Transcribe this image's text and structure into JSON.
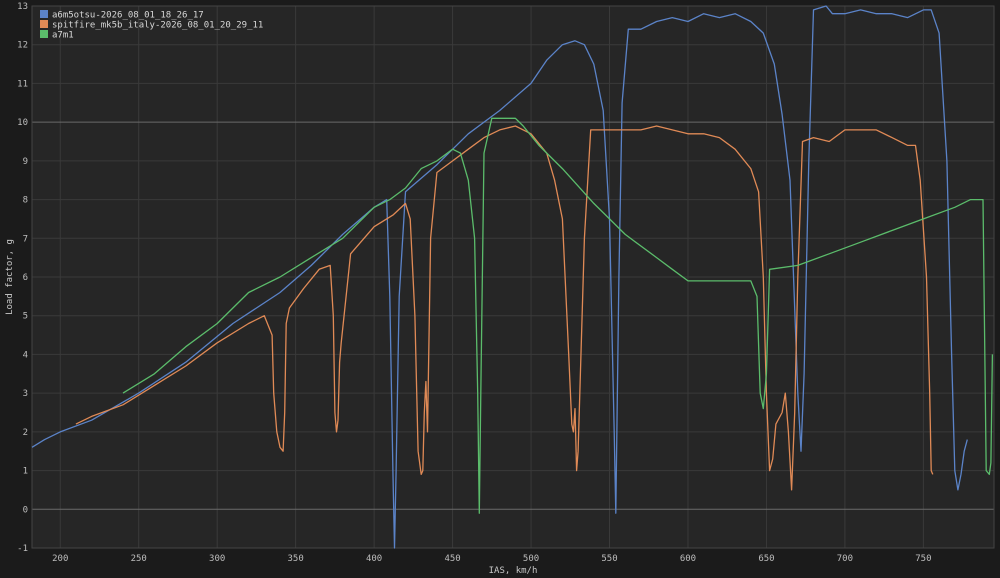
{
  "chart_data": {
    "type": "line",
    "xlabel": "IAS, km/h",
    "ylabel": "Load factor, g",
    "xlim": [
      182,
      795
    ],
    "ylim": [
      -1,
      13
    ],
    "xticks": [
      200,
      250,
      300,
      350,
      400,
      450,
      500,
      550,
      600,
      650,
      700,
      750
    ],
    "yticks": [
      -1,
      0,
      1,
      2,
      3,
      4,
      5,
      6,
      7,
      8,
      9,
      10,
      11,
      12,
      13
    ],
    "grid": true,
    "highlight_lines": [
      0,
      10
    ],
    "legend_position": "top-left",
    "series": [
      {
        "name": "a6m5otsu-2026_08_01_18_26_17",
        "color": "#5b83c8",
        "points": [
          [
            182,
            1.6
          ],
          [
            190,
            1.8
          ],
          [
            200,
            2.0
          ],
          [
            220,
            2.3
          ],
          [
            250,
            3.0
          ],
          [
            280,
            3.8
          ],
          [
            310,
            4.8
          ],
          [
            340,
            5.6
          ],
          [
            360,
            6.3
          ],
          [
            380,
            7.1
          ],
          [
            400,
            7.8
          ],
          [
            408,
            8.0
          ],
          [
            410,
            5.5
          ],
          [
            412,
            1.0
          ],
          [
            413,
            -1.0
          ],
          [
            414,
            1.0
          ],
          [
            416,
            5.5
          ],
          [
            420,
            8.2
          ],
          [
            440,
            8.9
          ],
          [
            460,
            9.7
          ],
          [
            480,
            10.3
          ],
          [
            500,
            11.0
          ],
          [
            510,
            11.6
          ],
          [
            520,
            12.0
          ],
          [
            528,
            12.1
          ],
          [
            534,
            12.0
          ],
          [
            540,
            11.5
          ],
          [
            546,
            10.3
          ],
          [
            550,
            7.5
          ],
          [
            553,
            2.0
          ],
          [
            554,
            -0.1
          ],
          [
            556,
            6.0
          ],
          [
            558,
            10.5
          ],
          [
            562,
            12.4
          ],
          [
            570,
            12.4
          ],
          [
            580,
            12.6
          ],
          [
            590,
            12.7
          ],
          [
            600,
            12.6
          ],
          [
            610,
            12.8
          ],
          [
            620,
            12.7
          ],
          [
            630,
            12.8
          ],
          [
            640,
            12.6
          ],
          [
            648,
            12.3
          ],
          [
            655,
            11.5
          ],
          [
            660,
            10.2
          ],
          [
            665,
            8.5
          ],
          [
            670,
            3.0
          ],
          [
            672,
            1.5
          ],
          [
            674,
            3.5
          ],
          [
            677,
            9.0
          ],
          [
            680,
            12.9
          ],
          [
            688,
            13.0
          ],
          [
            692,
            12.8
          ],
          [
            700,
            12.8
          ],
          [
            710,
            12.9
          ],
          [
            720,
            12.8
          ],
          [
            730,
            12.8
          ],
          [
            740,
            12.7
          ],
          [
            750,
            12.9
          ],
          [
            755,
            12.9
          ],
          [
            760,
            12.3
          ],
          [
            765,
            9.0
          ],
          [
            768,
            4.0
          ],
          [
            770,
            1.0
          ],
          [
            772,
            0.5
          ],
          [
            774,
            0.9
          ],
          [
            776,
            1.5
          ],
          [
            778,
            1.8
          ]
        ]
      },
      {
        "name": "spitfire_mk5b_italy-2026_08_01_20_29_11",
        "color": "#e08a56",
        "points": [
          [
            210,
            2.2
          ],
          [
            220,
            2.4
          ],
          [
            240,
            2.7
          ],
          [
            260,
            3.2
          ],
          [
            280,
            3.7
          ],
          [
            300,
            4.3
          ],
          [
            320,
            4.8
          ],
          [
            330,
            5.0
          ],
          [
            335,
            4.5
          ],
          [
            336,
            3.0
          ],
          [
            338,
            2.0
          ],
          [
            340,
            1.6
          ],
          [
            342,
            1.5
          ],
          [
            343,
            2.5
          ],
          [
            344,
            4.8
          ],
          [
            346,
            5.2
          ],
          [
            355,
            5.7
          ],
          [
            365,
            6.2
          ],
          [
            372,
            6.3
          ],
          [
            374,
            5.0
          ],
          [
            375,
            2.5
          ],
          [
            376,
            2.0
          ],
          [
            377,
            2.3
          ],
          [
            378,
            3.8
          ],
          [
            379,
            4.3
          ],
          [
            385,
            6.6
          ],
          [
            400,
            7.3
          ],
          [
            412,
            7.6
          ],
          [
            420,
            7.9
          ],
          [
            423,
            7.5
          ],
          [
            426,
            5.0
          ],
          [
            428,
            1.5
          ],
          [
            430,
            0.9
          ],
          [
            431,
            1.0
          ],
          [
            432,
            2.5
          ],
          [
            433,
            3.3
          ],
          [
            434,
            2.0
          ],
          [
            436,
            7.0
          ],
          [
            440,
            8.7
          ],
          [
            450,
            9.0
          ],
          [
            460,
            9.3
          ],
          [
            470,
            9.6
          ],
          [
            480,
            9.8
          ],
          [
            490,
            9.9
          ],
          [
            500,
            9.7
          ],
          [
            510,
            9.2
          ],
          [
            515,
            8.5
          ],
          [
            520,
            7.5
          ],
          [
            524,
            4.0
          ],
          [
            526,
            2.2
          ],
          [
            527,
            2.0
          ],
          [
            528,
            2.6
          ],
          [
            529,
            1.0
          ],
          [
            530,
            1.5
          ],
          [
            534,
            7.0
          ],
          [
            538,
            9.8
          ],
          [
            550,
            9.8
          ],
          [
            560,
            9.8
          ],
          [
            570,
            9.8
          ],
          [
            580,
            9.9
          ],
          [
            590,
            9.8
          ],
          [
            600,
            9.7
          ],
          [
            610,
            9.7
          ],
          [
            620,
            9.6
          ],
          [
            630,
            9.3
          ],
          [
            640,
            8.8
          ],
          [
            645,
            8.2
          ],
          [
            648,
            6.0
          ],
          [
            650,
            3.0
          ],
          [
            652,
            1.0
          ],
          [
            654,
            1.3
          ],
          [
            656,
            2.2
          ],
          [
            660,
            2.5
          ],
          [
            662,
            3.0
          ],
          [
            664,
            2.0
          ],
          [
            666,
            0.5
          ],
          [
            668,
            2.5
          ],
          [
            670,
            6.0
          ],
          [
            673,
            9.5
          ],
          [
            680,
            9.6
          ],
          [
            690,
            9.5
          ],
          [
            700,
            9.8
          ],
          [
            710,
            9.8
          ],
          [
            720,
            9.8
          ],
          [
            730,
            9.6
          ],
          [
            740,
            9.4
          ],
          [
            745,
            9.4
          ],
          [
            748,
            8.5
          ],
          [
            752,
            6.0
          ],
          [
            754,
            3.0
          ],
          [
            755,
            1.0
          ],
          [
            756,
            0.9
          ]
        ]
      },
      {
        "name": "a7m1",
        "color": "#5bbc6b",
        "points": [
          [
            240,
            3.0
          ],
          [
            260,
            3.5
          ],
          [
            280,
            4.2
          ],
          [
            300,
            4.8
          ],
          [
            320,
            5.6
          ],
          [
            340,
            6.0
          ],
          [
            360,
            6.5
          ],
          [
            380,
            7.0
          ],
          [
            400,
            7.8
          ],
          [
            410,
            8.0
          ],
          [
            420,
            8.3
          ],
          [
            430,
            8.8
          ],
          [
            440,
            9.0
          ],
          [
            450,
            9.3
          ],
          [
            455,
            9.2
          ],
          [
            460,
            8.5
          ],
          [
            464,
            7.0
          ],
          [
            466,
            3.0
          ],
          [
            467,
            -0.1
          ],
          [
            468,
            3.0
          ],
          [
            470,
            9.2
          ],
          [
            475,
            10.1
          ],
          [
            490,
            10.1
          ],
          [
            495,
            9.9
          ],
          [
            505,
            9.4
          ],
          [
            520,
            8.8
          ],
          [
            540,
            7.9
          ],
          [
            560,
            7.1
          ],
          [
            580,
            6.5
          ],
          [
            590,
            6.2
          ],
          [
            600,
            5.9
          ],
          [
            620,
            5.9
          ],
          [
            640,
            5.9
          ],
          [
            644,
            5.5
          ],
          [
            646,
            3.0
          ],
          [
            648,
            2.6
          ],
          [
            650,
            3.5
          ],
          [
            652,
            6.2
          ],
          [
            670,
            6.3
          ],
          [
            690,
            6.6
          ],
          [
            710,
            6.9
          ],
          [
            730,
            7.2
          ],
          [
            750,
            7.5
          ],
          [
            770,
            7.8
          ],
          [
            780,
            8.0
          ],
          [
            788,
            8.0
          ],
          [
            790,
            1.0
          ],
          [
            792,
            0.9
          ],
          [
            793,
            1.2
          ],
          [
            794,
            4.0
          ]
        ]
      }
    ]
  }
}
